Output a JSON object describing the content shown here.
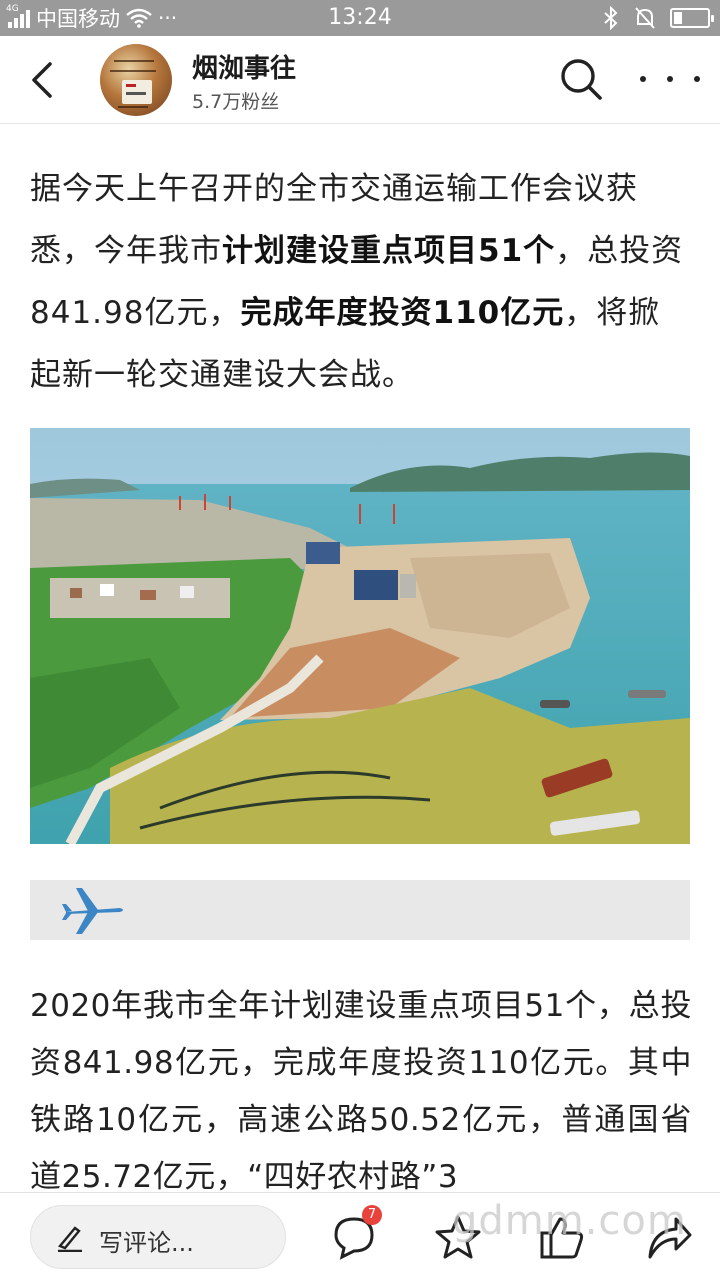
{
  "status_bar": {
    "network_tag": "4G",
    "carrier": "中国移动",
    "more": "···",
    "time": "13:24",
    "battery_level": 0.25
  },
  "header": {
    "account_name": "烟洳事往",
    "fans": "5.7万粉丝"
  },
  "article": {
    "p1_seg1": "据今天上午召开的全市交通运输工作会议获悉，今年我市",
    "p1_bold1": "计划建设重点项目51个",
    "p1_seg2": "，总投资841.98亿元，",
    "p1_bold2": "完成年度投资110亿元",
    "p1_seg3": "，将掀起新一轮交通建设大会战。",
    "p2": "2020年我市全年计划建设重点项目51个，总投资841.98亿元，完成年度投资110亿元。其中铁路10亿元，高速公路50.52亿元，普通国省道25.72亿元，“四好农村路”3"
  },
  "bottom_bar": {
    "comment_placeholder": "写评论...",
    "comment_count": "7"
  },
  "watermark": "gdmm.com",
  "colors": {
    "status_bar_bg": "#9a9a9a",
    "badge_red": "#e8423b",
    "plane_blue": "#3d86c6"
  }
}
